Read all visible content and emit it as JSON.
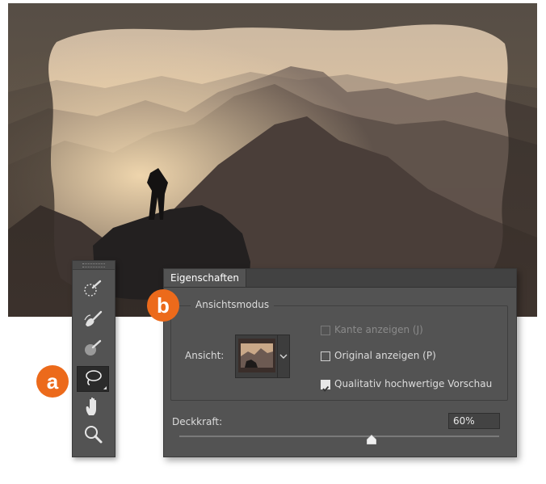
{
  "panel": {
    "tab_label": "Eigenschaften",
    "group_label": "Ansichtsmodus",
    "view_label": "Ansicht:",
    "options": [
      {
        "label": "Kante anzeigen (J)",
        "checked": false,
        "disabled": true
      },
      {
        "label": "Original anzeigen (P)",
        "checked": false,
        "disabled": false
      },
      {
        "label": "Qualitativ hochwertige Vorschau",
        "checked": true,
        "disabled": false
      }
    ],
    "opacity_label": "Deckkraft:",
    "opacity_value": "60%",
    "opacity_fraction": 0.6
  },
  "toolbar": {
    "tools": [
      {
        "icon": "quick-selection-icon",
        "active": false
      },
      {
        "icon": "refine-edge-brush-icon",
        "active": false
      },
      {
        "icon": "brush-icon",
        "active": false
      },
      {
        "icon": "lasso-icon",
        "active": true
      },
      {
        "icon": "hand-icon",
        "active": false
      },
      {
        "icon": "zoom-icon",
        "active": false
      }
    ]
  },
  "callouts": {
    "a": "a",
    "b": "b"
  },
  "colors": {
    "accent": "#ec6a1b",
    "panel_bg": "#535353"
  }
}
